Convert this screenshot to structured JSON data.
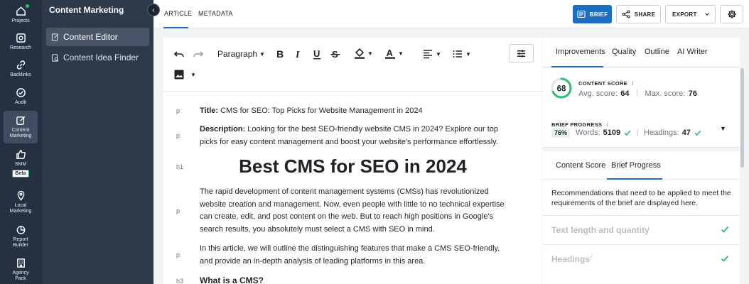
{
  "rail": {
    "items": [
      {
        "label": "Projects",
        "icon": "home-icon"
      },
      {
        "label": "Research",
        "icon": "research-icon"
      },
      {
        "label": "Backlinks",
        "icon": "link-icon"
      },
      {
        "label": "Audit",
        "icon": "check-circle-icon"
      },
      {
        "label": "Content Marketing",
        "icon": "edit-icon"
      },
      {
        "label": "SMM",
        "icon": "thumbs-up-icon",
        "badge": "Beta"
      },
      {
        "label": "Local Marketing",
        "icon": "location-icon"
      },
      {
        "label": "Report Builder",
        "icon": "pie-chart-icon"
      },
      {
        "label": "Agency Pack",
        "icon": "building-icon"
      }
    ]
  },
  "submenu": {
    "title": "Content Marketing",
    "items": [
      {
        "label": "Content Editor",
        "icon": "document-icon"
      },
      {
        "label": "Content Idea Finder",
        "icon": "idea-finder-icon"
      }
    ]
  },
  "topbar": {
    "tabs": [
      "ARTICLE",
      "METADATA"
    ],
    "brief": "BRIEF",
    "share": "SHARE",
    "export": "EXPORT"
  },
  "toolbar": {
    "paragraph": "Paragraph"
  },
  "content": {
    "title_label": "Title:",
    "title_text": " CMS for SEO: Top Picks for Website Management in 2024",
    "desc_label": "Description:",
    "desc_text": " Looking for the best SEO-friendly website CMS in 2024? Explore our top picks for easy content management and boost your website's performance effortlessly.",
    "h1": "Best CMS for SEO in 2024",
    "para1": "The rapid development of content management systems (CMSs) has revolutionized website creation and management. Now, even people with little to no technical expertise can create, edit, and post content on the web. But to reach high positions in Google's search results, you absolutely must select a CMS with SEO in mind.",
    "para2": "In this article, we will outline the distinguishing features that make a CMS SEO-friendly, and provide an in-depth analysis of leading platforms in this area.",
    "h3": "What is a CMS?",
    "tags": {
      "p": "p",
      "h1": "h1",
      "h3": "h3"
    }
  },
  "panel": {
    "tabs": [
      "Improvements",
      "Quality",
      "Outline",
      "AI Writer"
    ],
    "content_score_label": "CONTENT SCORE",
    "score": "68",
    "score_fraction": 0.68,
    "avg_label": "Avg. score:",
    "avg_value": "64",
    "max_label": "Max. score:",
    "max_value": "76",
    "brief_label": "BRIEF PROGRESS",
    "brief_pct": "76%",
    "words_label": "Words:",
    "words_value": "5109",
    "headings_label": "Headings:",
    "headings_value": "47",
    "subtabs": [
      "Content Score",
      "Brief Progress"
    ],
    "recommendation": "Recommendations that need to be applied to meet the requirements of the brief are displayed here.",
    "rows": [
      "Text length and quantity",
      "Headings"
    ],
    "info_mark": "i"
  },
  "colors": {
    "accent": "#1b6ec2",
    "success": "#2dbf72"
  }
}
